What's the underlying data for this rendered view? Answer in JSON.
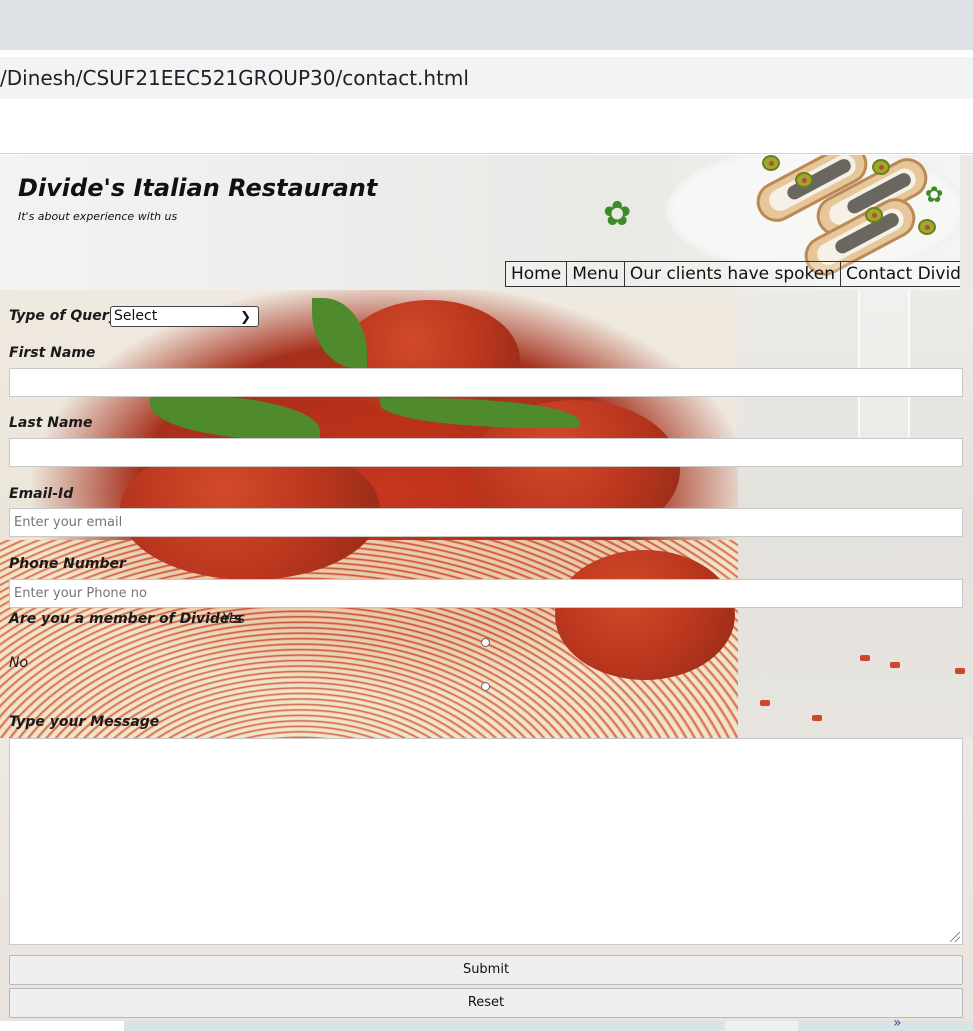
{
  "browser": {
    "url": "/Dinesh/CSUF21EEC521GROUP30/contact.html"
  },
  "header": {
    "title": "Divide's Italian Restaurant",
    "tagline": "It's about experience with us",
    "nav": [
      {
        "label": "Home"
      },
      {
        "label": "Menu"
      },
      {
        "label": "Our clients have spoken"
      },
      {
        "label": "Contact Divide"
      }
    ]
  },
  "form": {
    "query_label": "Type of Query",
    "query_selected": "Select",
    "first_name_label": "First Name",
    "first_name_value": "",
    "last_name_label": "Last Name",
    "last_name_value": "",
    "email_label": "Email-Id",
    "email_placeholder": "Enter your email",
    "phone_label": "Phone Number",
    "phone_placeholder": "Enter your Phone no",
    "member_label": "Are you a member of Divide's",
    "member_yes": "Yes",
    "member_no": "No",
    "message_label": "Type your Message",
    "message_value": "",
    "submit_label": "Submit",
    "reset_label": "Reset"
  },
  "footer": {
    "arrows_glyph": "»"
  },
  "colors": {
    "chrome_bg": "#dee1e6",
    "address_bar_bg": "#f1f3f4",
    "sauce_red": "#b42f19",
    "button_bg": "#efefef"
  }
}
